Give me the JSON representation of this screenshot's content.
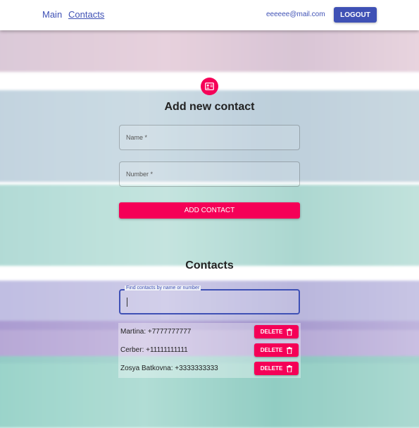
{
  "header": {
    "nav_main": "Main",
    "nav_contacts": "Contacts",
    "email": "eeeeee@mail.com",
    "logout_label": "LOGOUT"
  },
  "form": {
    "icon": "contact-card-icon",
    "title": "Add new contact",
    "name_label": "Name *",
    "number_label": "Number *",
    "submit_label": "ADD CONTACT"
  },
  "contacts": {
    "title": "Contacts",
    "search_label": "Find contacts by name or number",
    "search_value": "",
    "delete_label": "DELETE",
    "delete_icon": "trash-icon",
    "items": [
      {
        "text": "Martina: +7777777777"
      },
      {
        "text": "Cerber: +11111111111"
      },
      {
        "text": "Zosya Batkovna: +3333333333"
      }
    ]
  },
  "colors": {
    "primary": "#3f51b5",
    "secondary": "#f50057"
  }
}
